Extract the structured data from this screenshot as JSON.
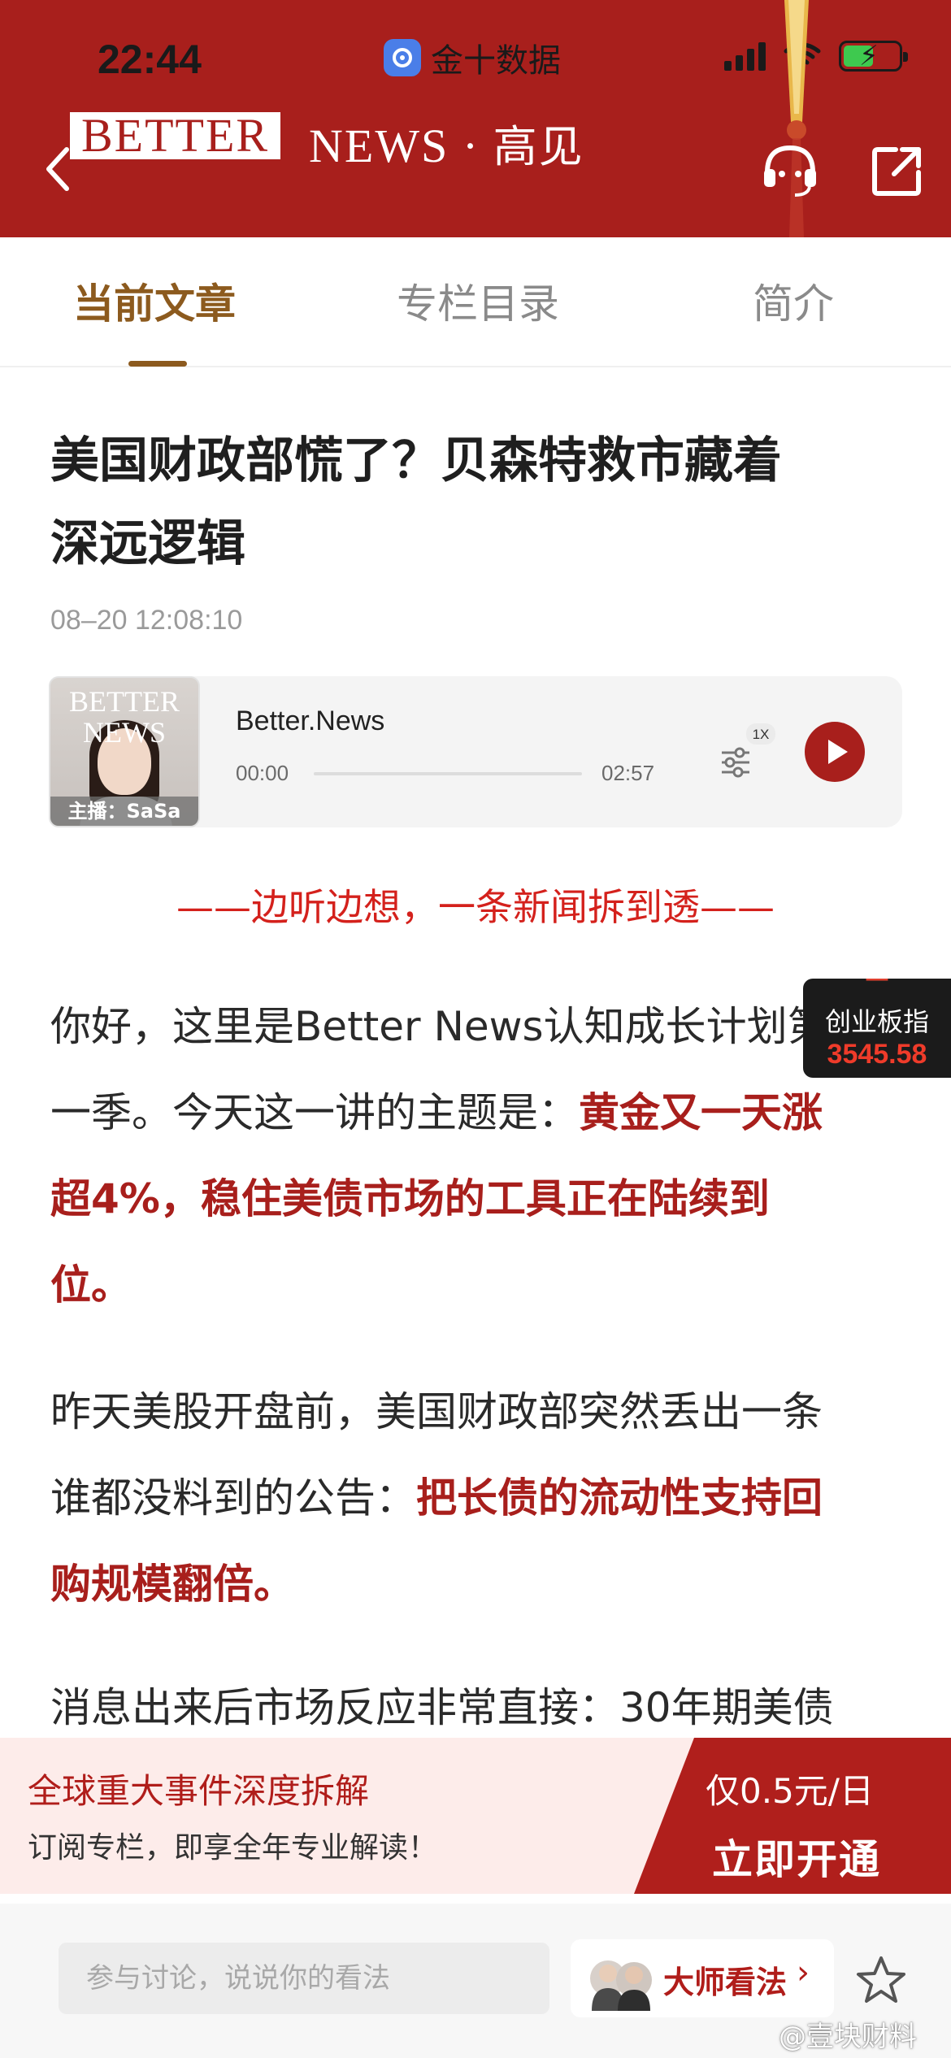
{
  "status_bar": {
    "time": "22:44",
    "app_name": "金十数据"
  },
  "header": {
    "brand_boxed": "BETTER",
    "brand_rest": "NEWS · ",
    "brand_cn": "高见",
    "icons": [
      "back-icon",
      "headset-icon",
      "share-icon"
    ],
    "color": "#a81f1c"
  },
  "tabs": [
    {
      "label": "当前文章",
      "active": true
    },
    {
      "label": "专栏目录",
      "active": false
    },
    {
      "label": "简介",
      "active": false
    }
  ],
  "article": {
    "title_line1": "美国财政部慌了？贝森特救市藏着",
    "title_line2": "深远逻辑",
    "date": "08–20 12:08:10",
    "slogan": "——边听边想，一条新闻拆到透——",
    "paragraphs": {
      "p1_line1": "你好，这里是Better News认知成长计划第",
      "p1_line2_plain": "一季。今天这一讲的主题是：",
      "p1_line2_hl": "黄金又一天涨",
      "p1_line3_hl": "超4%，稳住美债市场的工具正在陆续到",
      "p1_line4_hl": "位。",
      "p2_line1": "昨天美股开盘前，美国财政部突然丢出一条",
      "p2_line2_plain": "谁都没料到的公告：",
      "p2_line2_hl": "把长债的流动性支持回",
      "p2_line3_hl": "购规模翻倍。",
      "p3_line1": "消息出来后市场反应非常直接：30年期美债"
    }
  },
  "player": {
    "cover_brand_line1": "BETTER",
    "cover_brand_line2": "NEWS",
    "host_caption": "主播：SaSa",
    "name": "Better.News",
    "current_time": "00:00",
    "duration": "02:57",
    "progress": 0,
    "speed": "1X"
  },
  "ticker": {
    "name": "创业板指",
    "value": "3545.58",
    "color": "#ef3b2a"
  },
  "banner": {
    "title": "全球重大事件深度拆解",
    "subtitle": "订阅专栏，即享全年专业解读！",
    "price": "仅0.5元/日",
    "cta": "立即开通"
  },
  "bottom_bar": {
    "comment_placeholder": "参与讨论，说说你的看法",
    "master_label": "大师看法",
    "master_chevron": "›"
  },
  "watermark": "@壹块财料"
}
